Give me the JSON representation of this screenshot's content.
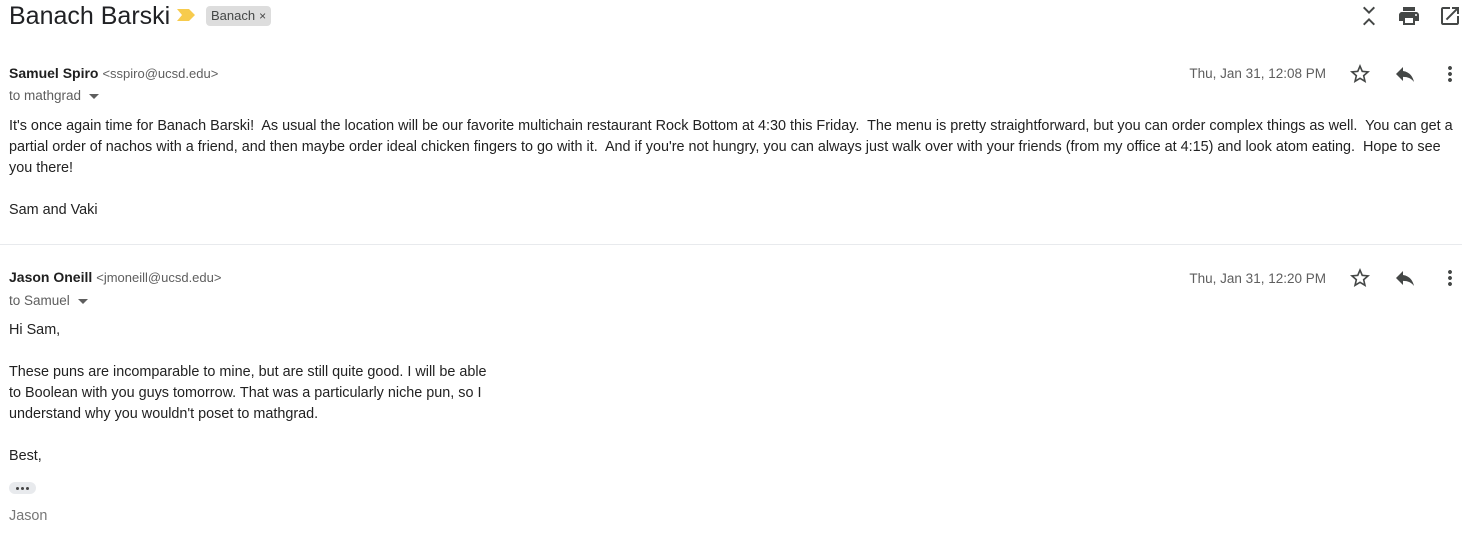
{
  "thread": {
    "subject": "Banach Barski",
    "label": "Banach",
    "label_remove": "×",
    "icons": [
      "important-marker-icon",
      "collapse-all-icon",
      "print-icon",
      "open-new-window-icon"
    ]
  },
  "messages": [
    {
      "sender_name": "Samuel Spiro",
      "sender_email": "<sspiro@ucsd.edu>",
      "to": "to mathgrad",
      "date": "Thu, Jan 31, 12:08 PM",
      "body": [
        "It's once again time for Banach Barski!  As usual the location will be our favorite multichain restaurant Rock Bottom at 4:30 this Friday.  The menu is pretty straightforward, but you can order complex things as well.  You can get a partial order of nachos with a friend, and then maybe order ideal chicken fingers to go with it.  And if you're not hungry, you can always just walk over with your friends (from my office at 4:15) and look atom eating.  Hope to see you there!",
        "Sam and Vaki"
      ]
    },
    {
      "sender_name": "Jason Oneill",
      "sender_email": "<jmoneill@ucsd.edu>",
      "to": "to Samuel",
      "date": "Thu, Jan 31, 12:20 PM",
      "body": [
        "Hi Sam,",
        "These puns are incomparable to mine, but are still quite good. I will be able to Boolean with you guys tomorrow. That was a particularly niche pun, so I understand why you wouldn't poset to mathgrad.",
        "Best,"
      ],
      "signature": "Jason"
    }
  ]
}
